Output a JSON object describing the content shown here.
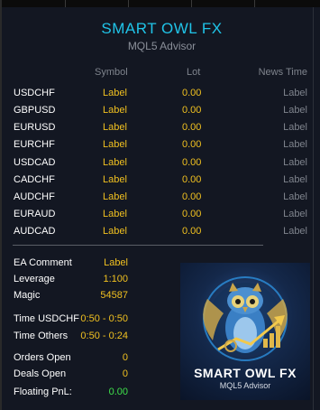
{
  "header": {
    "title": "SMART OWL FX",
    "subtitle": "MQL5 Advisor"
  },
  "table": {
    "columns": {
      "symbol": "Symbol",
      "lot": "Lot",
      "news": "News Time"
    },
    "rows": [
      {
        "symbol": "USDCHF",
        "label": "Label",
        "lot": "0.00",
        "news": "Label"
      },
      {
        "symbol": "GBPUSD",
        "label": "Label",
        "lot": "0.00",
        "news": "Label"
      },
      {
        "symbol": "EURUSD",
        "label": "Label",
        "lot": "0.00",
        "news": "Label"
      },
      {
        "symbol": "EURCHF",
        "label": "Label",
        "lot": "0.00",
        "news": "Label"
      },
      {
        "symbol": "USDCAD",
        "label": "Label",
        "lot": "0.00",
        "news": "Label"
      },
      {
        "symbol": "CADCHF",
        "label": "Label",
        "lot": "0.00",
        "news": "Label"
      },
      {
        "symbol": "AUDCHF",
        "label": "Label",
        "lot": "0.00",
        "news": "Label"
      },
      {
        "symbol": "EURAUD",
        "label": "Label",
        "lot": "0.00",
        "news": "Label"
      },
      {
        "symbol": "AUDCAD",
        "label": "Label",
        "lot": "0.00",
        "news": "Label"
      }
    ]
  },
  "info": {
    "ea_comment": {
      "key": "EA Comment",
      "value": "Label"
    },
    "leverage": {
      "key": "Leverage",
      "value": "1:100"
    },
    "magic": {
      "key": "Magic",
      "value": "54587"
    },
    "time_usdchf": {
      "key": "Time USDCHF",
      "value": "0:50 - 0:50"
    },
    "time_others": {
      "key": "Time Others",
      "value": "0:50 - 0:24"
    },
    "orders_open": {
      "key": "Orders Open",
      "value": "0"
    },
    "deals_open": {
      "key": "Deals Open",
      "value": "0"
    },
    "floating_pnl": {
      "key": "Floating PnL:",
      "value": "0.00"
    }
  },
  "logo": {
    "name": "SMART OWL FX",
    "tagline": "MQL5 Advisor",
    "icon": "owl-logo-icon"
  },
  "colors": {
    "accent": "#20c4e8",
    "value": "#f0c020",
    "positive": "#3ee04a",
    "muted": "#7f848d",
    "background": "#131722"
  }
}
